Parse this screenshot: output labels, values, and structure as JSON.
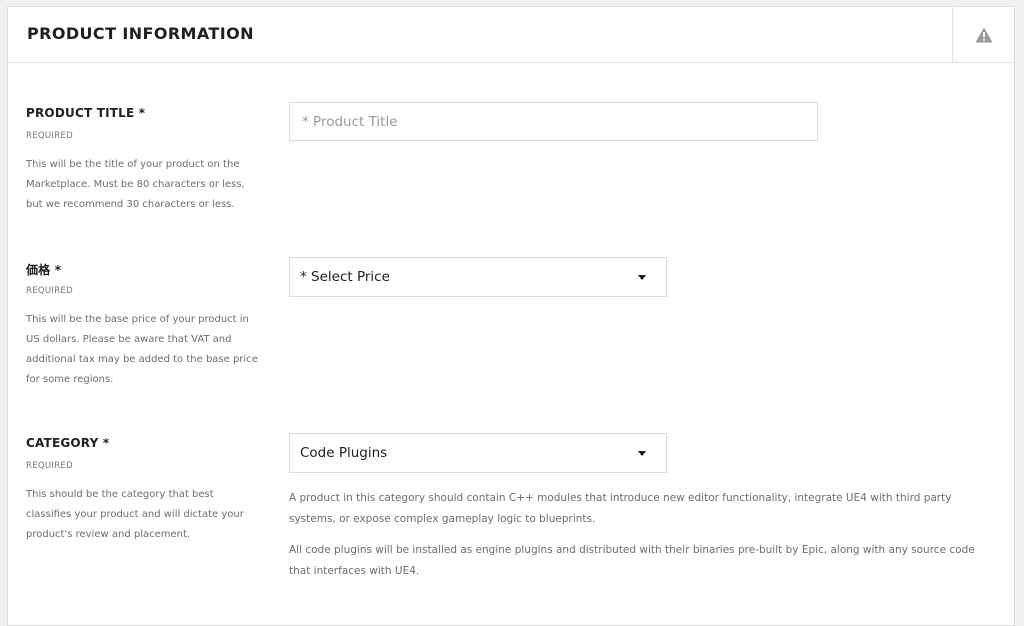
{
  "header": {
    "title": "PRODUCT INFORMATION",
    "icon": "warning-icon"
  },
  "product_title": {
    "label": "PRODUCT TITLE *",
    "required": "REQUIRED",
    "description": "This will be the title of your product on the Marketplace. Must be 80 characters or less, but we recommend 30 characters or less.",
    "placeholder": "* Product Title",
    "value": ""
  },
  "price": {
    "label": "価格 *",
    "required": "REQUIRED",
    "description": "This will be the base price of your product in US dollars. Please be aware that VAT and additional tax may be added to the base price for some regions.",
    "selected": "* Select Price"
  },
  "category": {
    "label": "CATEGORY *",
    "required": "REQUIRED",
    "description": "This should be the category that best classifies your product and will dictate your product's review and placement.",
    "selected": "Code Plugins",
    "info": [
      "A product in this category should contain C++ modules that introduce new editor functionality, integrate UE4 with third party systems, or expose complex gameplay logic to blueprints.",
      "All code plugins will be installed as engine plugins and distributed with their binaries pre-built by Epic, along with any source code that interfaces with UE4."
    ]
  },
  "colors": {
    "panel_bg": "#ffffff",
    "page_bg": "#f0f0f0",
    "border": "#dcdcdc",
    "warning_icon": "#9a9a9a"
  }
}
